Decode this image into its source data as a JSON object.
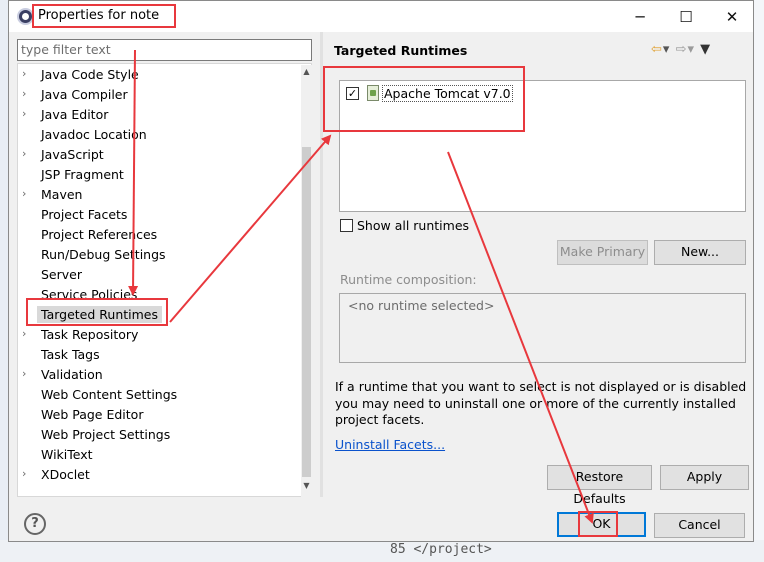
{
  "window": {
    "title": "Properties for note",
    "minimize_icon": "─",
    "maximize_icon": "☐",
    "close_icon": "✕"
  },
  "filter": {
    "placeholder": "type filter text"
  },
  "tree": [
    {
      "label": "Java Code Style",
      "expandable": true
    },
    {
      "label": "Java Compiler",
      "expandable": true
    },
    {
      "label": "Java Editor",
      "expandable": true
    },
    {
      "label": "Javadoc Location",
      "expandable": false
    },
    {
      "label": "JavaScript",
      "expandable": true
    },
    {
      "label": "JSP Fragment",
      "expandable": false
    },
    {
      "label": "Maven",
      "expandable": true
    },
    {
      "label": "Project Facets",
      "expandable": false
    },
    {
      "label": "Project References",
      "expandable": false
    },
    {
      "label": "Run/Debug Settings",
      "expandable": false
    },
    {
      "label": "Server",
      "expandable": false
    },
    {
      "label": "Service Policies",
      "expandable": false
    },
    {
      "label": "Targeted Runtimes",
      "expandable": false,
      "selected": true
    },
    {
      "label": "Task Repository",
      "expandable": true
    },
    {
      "label": "Task Tags",
      "expandable": false
    },
    {
      "label": "Validation",
      "expandable": true
    },
    {
      "label": "Web Content Settings",
      "expandable": false
    },
    {
      "label": "Web Page Editor",
      "expandable": false
    },
    {
      "label": "Web Project Settings",
      "expandable": false
    },
    {
      "label": "WikiText",
      "expandable": false
    },
    {
      "label": "XDoclet",
      "expandable": true
    }
  ],
  "page": {
    "title": "Targeted Runtimes",
    "runtimes": [
      {
        "label": "Apache Tomcat v7.0",
        "checked": true
      }
    ],
    "show_all_label": "Show all runtimes",
    "make_primary_label": "Make Primary",
    "new_label": "New...",
    "composition_label": "Runtime composition:",
    "composition_placeholder": "<no runtime selected>",
    "info_text": "If a runtime that you want to select is not displayed or is disabled you may need to uninstall one or more of the currently installed project facets.",
    "uninstall_link": "Uninstall Facets...",
    "restore_defaults_label": "Restore Defaults",
    "apply_label": "Apply"
  },
  "footer": {
    "help_icon": "?",
    "ok_label": "OK",
    "cancel_label": "Cancel"
  },
  "background": {
    "code_fragment": "85 </project>"
  },
  "colors": {
    "annotation_red": "#e8383d",
    "default_button_border": "#0078d7",
    "link_blue": "#0a52cc"
  }
}
